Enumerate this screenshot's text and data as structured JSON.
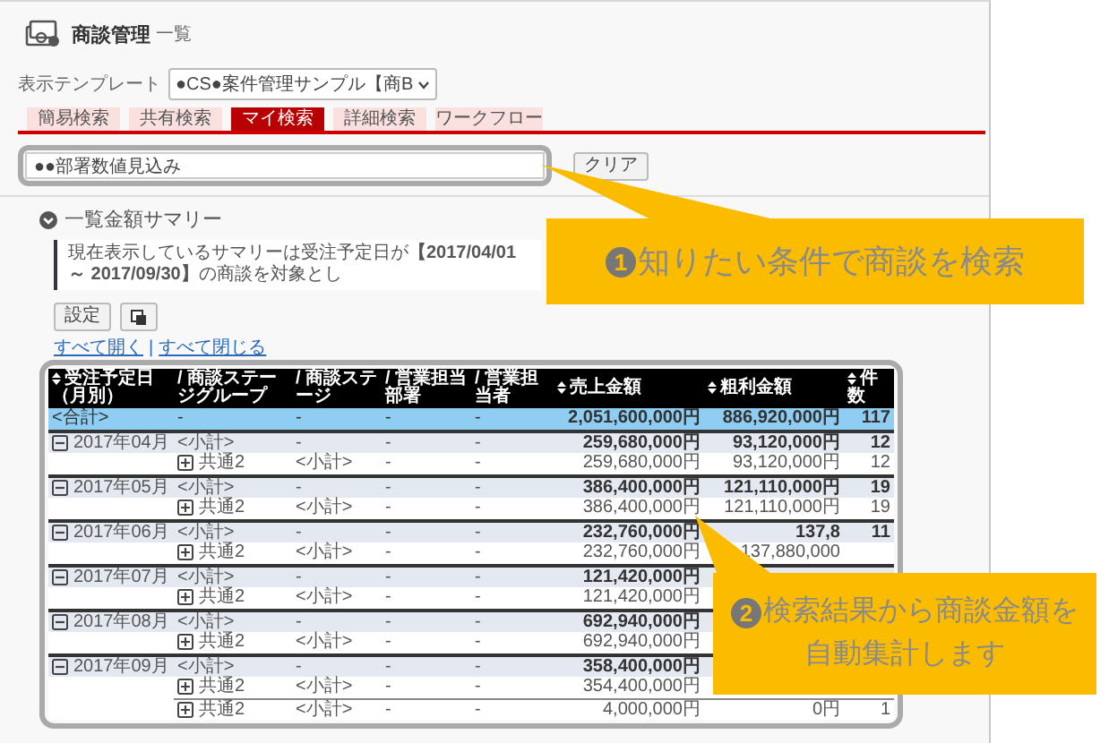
{
  "header": {
    "title": "商談管理",
    "subtitle": "一覧"
  },
  "template": {
    "label": "表示テンプレート",
    "value": "●CS●案件管理サンプル【商B"
  },
  "tabs": [
    {
      "label": "簡易検索",
      "selected": false
    },
    {
      "label": "共有検索",
      "selected": false
    },
    {
      "label": "マイ検索",
      "selected": true
    },
    {
      "label": "詳細検索",
      "selected": false
    },
    {
      "label": "ワークフロー",
      "selected": false
    }
  ],
  "search": {
    "value": "●●部署数値見込み",
    "clear_label": "クリア"
  },
  "summary": {
    "title": "一覧金額サマリー",
    "expanded": true,
    "notice": "現在表示しているサマリーは受注予定日が**【2017/04/01 ～ 2017/09/30】**の商談を対象とし",
    "settings_label": "設定"
  },
  "links": [
    "すべて開く",
    "|",
    "すべて閉じる"
  ],
  "table": {
    "columns": [
      {
        "label": "受注予定日（月別）",
        "sortable": true
      },
      {
        "label": "/ 商談ステージグループ",
        "sortable": false
      },
      {
        "label": "/ 商談ステージ",
        "sortable": false
      },
      {
        "label": "/ 営業担当部署",
        "sortable": false
      },
      {
        "label": "/ 営業担当者",
        "sortable": false
      },
      {
        "label": "売上金額",
        "sortable": true
      },
      {
        "label": "粗利金額",
        "sortable": true
      },
      {
        "label": "件数",
        "sortable": true
      }
    ],
    "rows": [
      {
        "kind": "total",
        "cells": [
          "<合計>",
          "-",
          "-",
          "-",
          "-",
          "2,051,600,000円",
          "886,920,000円",
          "117"
        ]
      },
      {
        "kind": "month",
        "expanded": true,
        "cells": [
          "2017年04月",
          "<小計>",
          "-",
          "-",
          "-",
          "259,680,000円",
          "93,120,000円",
          "12"
        ]
      },
      {
        "kind": "item",
        "expanded": false,
        "cells": [
          "",
          "共通2",
          "<小計>",
          "-",
          "-",
          "259,680,000円",
          "93,120,000円",
          "12"
        ]
      },
      {
        "kind": "month",
        "expanded": true,
        "cells": [
          "2017年05月",
          "<小計>",
          "-",
          "-",
          "-",
          "386,400,000円",
          "121,110,000円",
          "19"
        ]
      },
      {
        "kind": "item",
        "expanded": false,
        "cells": [
          "",
          "共通2",
          "<小計>",
          "-",
          "-",
          "386,400,000円",
          "121,110,000円",
          "19"
        ]
      },
      {
        "kind": "month",
        "expanded": true,
        "cells": [
          "2017年06月",
          "<小計>",
          "-",
          "-",
          "-",
          "232,760,000円",
          "137,8",
          "11"
        ]
      },
      {
        "kind": "item",
        "expanded": false,
        "cells": [
          "",
          "共通2",
          "<小計>",
          "-",
          "-",
          "232,760,000円",
          "137,880,000"
        ]
      },
      {
        "kind": "month",
        "expanded": true,
        "cells": [
          "2017年07月",
          "<小計>",
          "-",
          "-",
          "-",
          "121,420,000円"
        ]
      },
      {
        "kind": "item",
        "expanded": false,
        "cells": [
          "",
          "共通2",
          "<小計>",
          "-",
          "-",
          "121,420,000円"
        ]
      },
      {
        "kind": "month",
        "expanded": true,
        "cells": [
          "2017年08月",
          "<小計>",
          "-",
          "-",
          "-",
          "692,940,000円"
        ]
      },
      {
        "kind": "item",
        "expanded": false,
        "cells": [
          "",
          "共通2",
          "<小計>",
          "-",
          "-",
          "692,940,000円"
        ]
      },
      {
        "kind": "month",
        "expanded": true,
        "cells": [
          "2017年09月",
          "<小計>",
          "-",
          "-",
          "-",
          "358,400,000円"
        ]
      },
      {
        "kind": "item",
        "expanded": false,
        "cells": [
          "",
          "共通2",
          "<小計>",
          "-",
          "-",
          "354,400,000円"
        ]
      },
      {
        "kind": "item",
        "expanded": false,
        "cells": [
          "",
          "共通2",
          "<小計>",
          "-",
          "-",
          "4,000,000円",
          "0円",
          "1"
        ]
      }
    ]
  },
  "callouts": [
    {
      "number": "1",
      "lines": [
        "知りたい条件で商談を検索"
      ]
    },
    {
      "number": "2",
      "lines": [
        "検索結果から商談金額を",
        "自動集計します"
      ]
    }
  ]
}
